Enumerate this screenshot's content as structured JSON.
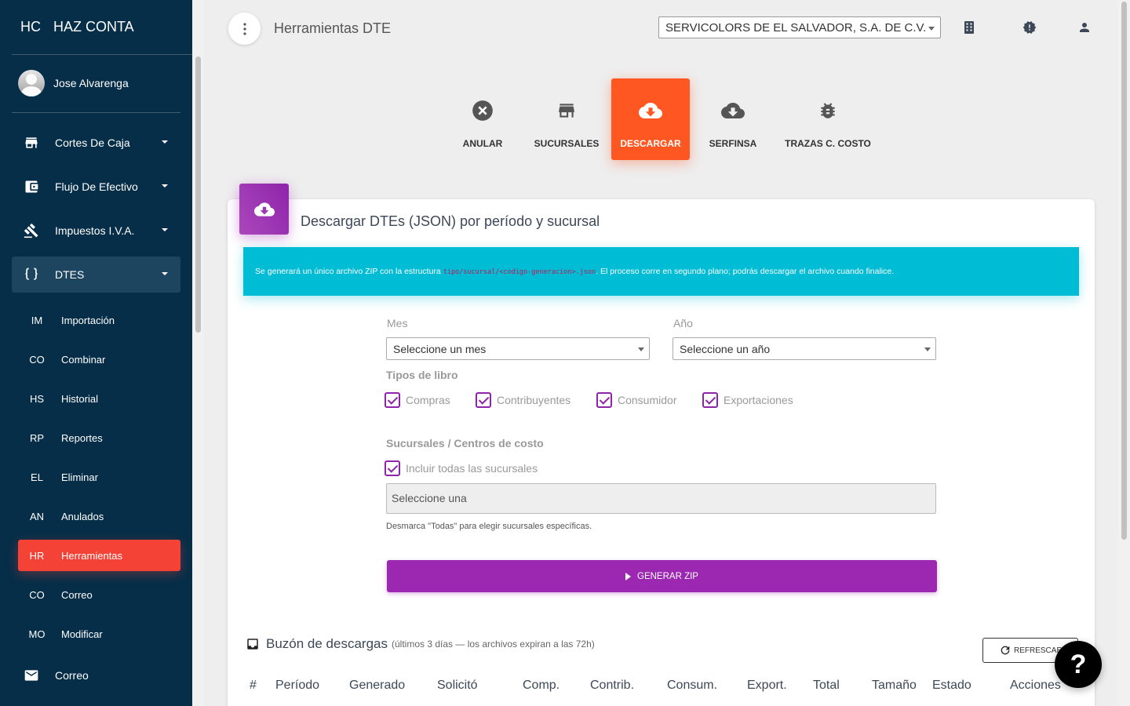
{
  "brand": {
    "mini": "HC",
    "full": "HAZ CONTA"
  },
  "user": {
    "name": "Jose Alvarenga"
  },
  "nav": [
    {
      "label": "Cortes De Caja",
      "icon": "store-icon"
    },
    {
      "label": "Flujo De Efectivo",
      "icon": "wallet-icon"
    },
    {
      "label": "Impuestos I.V.A.",
      "icon": "gavel-icon"
    },
    {
      "label": "DTES",
      "icon": "braces-icon"
    }
  ],
  "dtes_sub": [
    {
      "abbr": "IM",
      "label": "Importación"
    },
    {
      "abbr": "CO",
      "label": "Combinar"
    },
    {
      "abbr": "HS",
      "label": "Historial"
    },
    {
      "abbr": "RP",
      "label": "Reportes"
    },
    {
      "abbr": "EL",
      "label": "Eliminar"
    },
    {
      "abbr": "AN",
      "label": "Anulados"
    },
    {
      "abbr": "HR",
      "label": "Herramientas"
    },
    {
      "abbr": "CO",
      "label": "Correo"
    },
    {
      "abbr": "MO",
      "label": "Modificar"
    }
  ],
  "nav_bottom": {
    "label": "Correo",
    "icon": "mail-icon"
  },
  "header": {
    "title": "Herramientas DTE",
    "company": "SERVICOLORS DE EL SALVADOR, S.A. DE C.V."
  },
  "tabs": [
    {
      "label": "ANULAR",
      "icon": "cancel-icon"
    },
    {
      "label": "SUCURSALES",
      "icon": "store-icon"
    },
    {
      "label": "DESCARGAR",
      "icon": "cloud-download-icon"
    },
    {
      "label": "SERFINSA",
      "icon": "cloud-download-icon"
    },
    {
      "label": "TRAZAS C. COSTO",
      "icon": "bug-icon"
    }
  ],
  "card": {
    "title": "Descargar DTEs (JSON) por período y sucursal",
    "info_pre": "Se generará un único archivo ZIP con la estructura ",
    "info_code": "tipo/sucursal/<codigo-generacion>.json",
    "info_post": ". El proceso corre en segundo plano; podrás descargar el archivo cuando finalice.",
    "month_label": "Mes",
    "month_value": "Seleccione un mes",
    "year_label": "Año",
    "year_value": "Seleccione un año",
    "book_types_title": "Tipos de libro",
    "book_types": [
      "Compras",
      "Contribuyentes",
      "Consumidor",
      "Exportaciones"
    ],
    "branches_title": "Sucursales / Centros de costo",
    "all_branches_label": "Incluir todas las sucursales",
    "branch_placeholder": "Seleccione una",
    "branch_help": "Desmarca \"Todas\" para elegir sucursales específicas.",
    "generate_label": "GENERAR ZIP"
  },
  "inbox": {
    "title": "Buzón de descargas",
    "subtitle": "(últimos 3 días — los archivos expiran a las 72h)",
    "refresh_label": "REFRESCAR",
    "columns": [
      "#",
      "Período",
      "Generado",
      "Solicitó",
      "Comp.",
      "Contrib.",
      "Consum.",
      "Export.",
      "Total",
      "Tamaño",
      "Estado",
      "Acciones"
    ]
  },
  "help_fab": "?",
  "colors": {
    "sidebar": "#062e48",
    "active_tab": "#ff5722",
    "purple": "#9c27b0",
    "info": "#00bcd4",
    "active_sub": "#f44336"
  }
}
